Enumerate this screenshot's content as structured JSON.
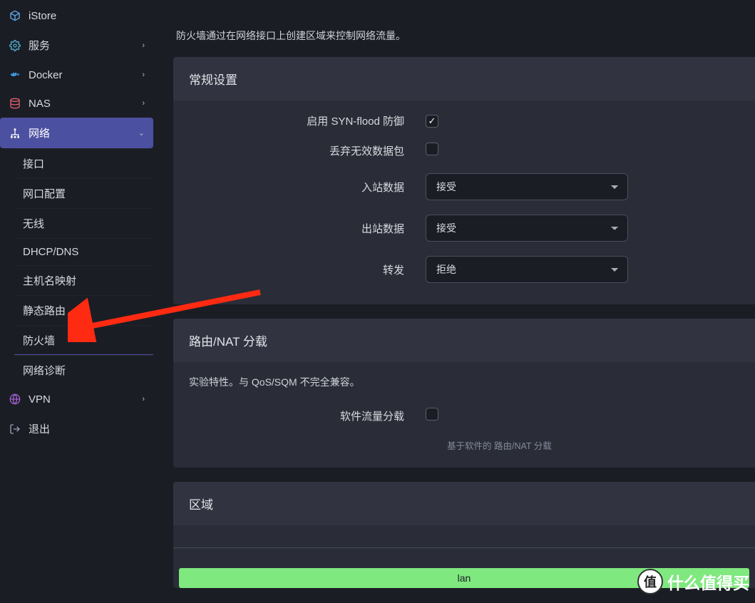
{
  "sidebar": {
    "items": [
      {
        "label": "iStore",
        "icon": "cube"
      },
      {
        "label": "服务",
        "icon": "gear",
        "expandable": true
      },
      {
        "label": "Docker",
        "icon": "whale",
        "expandable": true
      },
      {
        "label": "NAS",
        "icon": "stack",
        "expandable": true
      },
      {
        "label": "网络",
        "icon": "sitemap",
        "expandable": true,
        "expanded": true,
        "active": true
      },
      {
        "label": "VPN",
        "icon": "globe",
        "expandable": true
      },
      {
        "label": "退出",
        "icon": "logout"
      }
    ],
    "submenu": [
      "接口",
      "网口配置",
      "无线",
      "DHCP/DNS",
      "主机名映射",
      "静态路由",
      "防火墙",
      "网络诊断"
    ],
    "submenu_selected": "防火墙"
  },
  "page": {
    "intro": "防火墙通过在网络接口上创建区域来控制网络流量。",
    "section_general": "常规设置",
    "section_nat": "路由/NAT 分载",
    "section_nat_note": "实验特性。与 QoS/SQM 不完全兼容。",
    "section_zones": "区域",
    "fields": {
      "syn_flood": {
        "label": "启用 SYN-flood 防御",
        "checked": true
      },
      "drop_invalid": {
        "label": "丢弃无效数据包",
        "checked": false
      },
      "input": {
        "label": "入站数据",
        "value": "接受"
      },
      "output": {
        "label": "出站数据",
        "value": "接受"
      },
      "forward": {
        "label": "转发",
        "value": "拒绝"
      },
      "sw_offload": {
        "label": "软件流量分载",
        "checked": false,
        "hint": "基于软件的 路由/NAT 分载"
      }
    },
    "zone_row": "lan"
  },
  "watermark": "什么值得买",
  "watermark_badge": "值"
}
